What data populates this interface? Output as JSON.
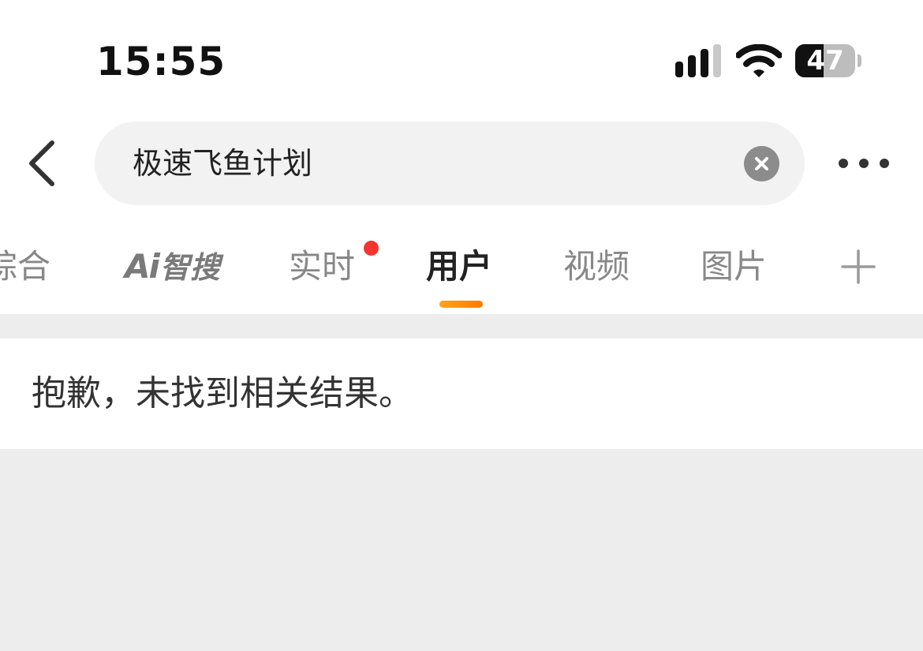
{
  "status_bar": {
    "time": "15:55",
    "battery_level": "47",
    "battery_fraction": 0.47
  },
  "search": {
    "query": "极速飞鱼计划",
    "icons": {
      "back": "chevron-left-icon",
      "clear": "clear-circle-icon",
      "more": "more-dots-icon"
    }
  },
  "tabs": {
    "items": [
      {
        "label": "综合",
        "active": false
      },
      {
        "label": "Ai",
        "suffix": "智搜",
        "active": false
      },
      {
        "label": "实时",
        "active": false,
        "badge": true
      },
      {
        "label": "用户",
        "active": true
      },
      {
        "label": "视频",
        "active": false
      },
      {
        "label": "图片",
        "active": false
      }
    ],
    "add_icon": "plus-icon"
  },
  "result": {
    "message": "抱歉，未找到相关结果。"
  },
  "colors": {
    "accent": "#ff8a00",
    "badge": "#f43530",
    "background": "#ededed"
  }
}
